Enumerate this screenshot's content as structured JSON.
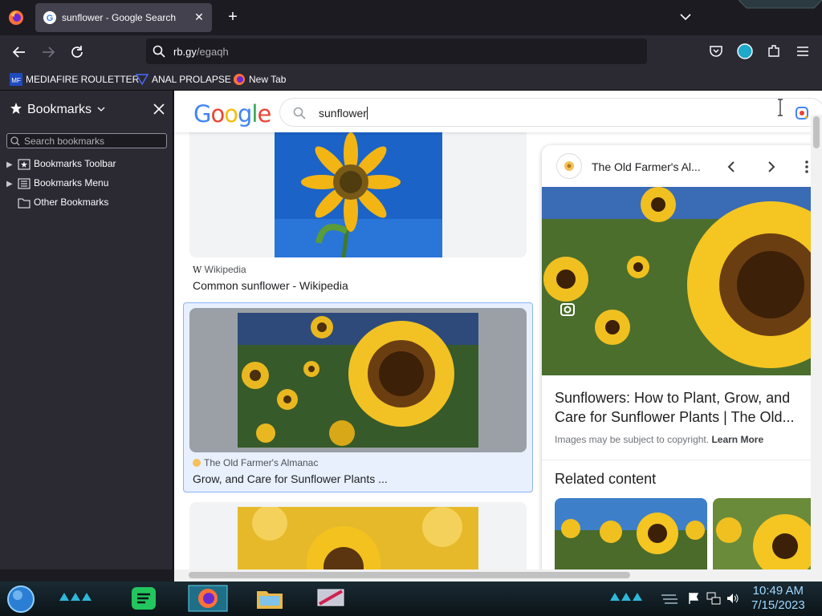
{
  "browser": {
    "tab": {
      "title": "sunflower - Google Search"
    },
    "url": {
      "host": "rb.gy",
      "path": "/egaqh"
    },
    "bookmarks_bar": [
      {
        "label": "MEDIAFIRE ROULETTER",
        "icon": "mediafire-icon"
      },
      {
        "label": "ANAL PROLAPSE",
        "icon": "bookmark-icon"
      },
      {
        "label": "New Tab",
        "icon": "firefox-icon"
      }
    ]
  },
  "sidebar": {
    "title": "Bookmarks",
    "search_placeholder": "Search bookmarks",
    "items": [
      {
        "label": "Bookmarks Toolbar",
        "expandable": true
      },
      {
        "label": "Bookmarks Menu",
        "expandable": true
      },
      {
        "label": "Other Bookmarks",
        "expandable": false
      }
    ]
  },
  "google": {
    "logo": "Google",
    "query": "sunflower",
    "results": [
      {
        "source": "Wikipedia",
        "title": "Common sunflower - Wikipedia"
      },
      {
        "source": "The Old Farmer's Almanac",
        "title": "Grow, and Care for Sunflower Plants ..."
      }
    ],
    "panel": {
      "source": "The Old Farmer's Al...",
      "title": "Sunflowers: How to Plant, Grow, and Care for Sunflower Plants | The Old...",
      "copyright": "Images may be subject to copyright.",
      "learn_more": "Learn More",
      "related": "Related content"
    }
  },
  "taskbar": {
    "time": "10:49 AM",
    "date": "7/15/2023"
  },
  "colors": {
    "google_blue": "#4285f4",
    "google_red": "#ea4335",
    "google_yellow": "#fbbc05",
    "google_green": "#34a853",
    "accent": "#8ab4f8"
  }
}
